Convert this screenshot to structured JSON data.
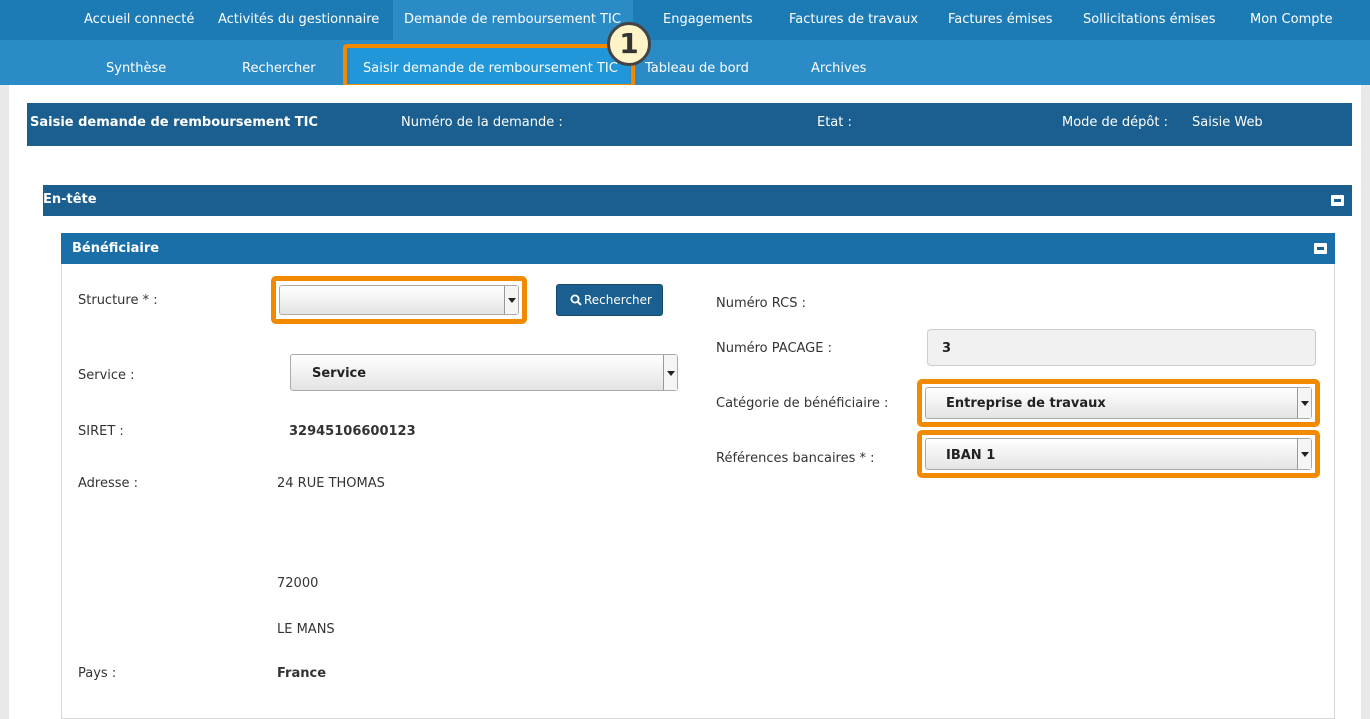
{
  "nav_top": {
    "items": [
      "Accueil connecté",
      "Activités du gestionnaire",
      "Demande de remboursement TIC",
      "Engagements",
      "Factures de travaux",
      "Factures émises",
      "Sollicitations émises",
      "Mon Compte"
    ],
    "active_index": 2
  },
  "nav_sub": {
    "items": [
      "Synthèse",
      "Rechercher",
      "Saisir demande de remboursement TIC",
      "Tableau de bord",
      "Archives"
    ],
    "active_index": 2
  },
  "step_badge": "1",
  "header": {
    "title": "Saisie demande de remboursement TIC",
    "numero_label": "Numéro de la demande :",
    "etat_label": "Etat :",
    "mode_label": "Mode de dépôt :",
    "mode_value": "Saisie Web"
  },
  "section_entete": "En-tête",
  "section_beneficiaire": "Bénéficiaire",
  "form_left": {
    "structure_label": "Structure * :",
    "structure_value": "",
    "search_button": "Rechercher",
    "service_label": "Service :",
    "service_value": "Service",
    "siret_label": "SIRET :",
    "siret_value": "32945106600123",
    "adresse_label": "Adresse :",
    "adresse_line1": "24 RUE THOMAS",
    "adresse_cp": "72000",
    "adresse_ville": "LE MANS",
    "pays_label": "Pays :",
    "pays_value": "France"
  },
  "form_right": {
    "rcs_label": "Numéro RCS :",
    "pacage_label": "Numéro PACAGE :",
    "pacage_value": "3",
    "categorie_label": "Catégorie de bénéficiaire :",
    "categorie_value": "Entreprise de travaux",
    "banque_label": "Références bancaires * :",
    "banque_value": "IBAN 1"
  },
  "colors": {
    "nav_top_bg": "#1c7ab5",
    "nav_sub_bg": "#2a8bc7",
    "header_bg": "#1a5f8f",
    "highlight": "#f28a00"
  }
}
